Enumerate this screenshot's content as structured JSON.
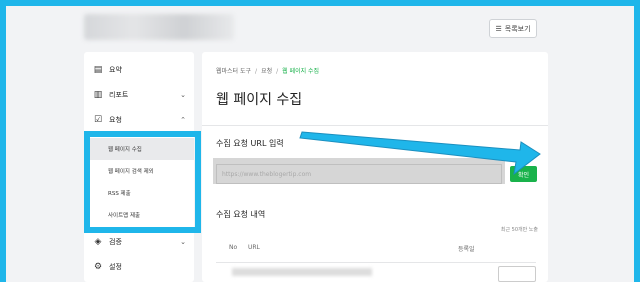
{
  "header": {
    "list_button_label": "목록보기",
    "list_icon": "list-icon"
  },
  "sidebar": {
    "items": [
      {
        "label": "요약",
        "icon": "clipboard-icon"
      },
      {
        "label": "리포트",
        "icon": "report-icon"
      },
      {
        "label": "요청",
        "icon": "checklist-icon"
      },
      {
        "label": "검증",
        "icon": "verify-icon"
      },
      {
        "label": "설정",
        "icon": "gear-icon"
      }
    ],
    "sub_items": [
      {
        "label": "웹 페이지 수집",
        "active": true
      },
      {
        "label": "웹 페이지 검색 제외",
        "active": false
      },
      {
        "label": "RSS 제출",
        "active": false
      },
      {
        "label": "사이트맵 제출",
        "active": false
      }
    ]
  },
  "main": {
    "breadcrumb": [
      "웹마스터 도구",
      "요청",
      "웹 페이지 수집"
    ],
    "title": "웹 페이지 수집",
    "url_section_title": "수집 요청 URL 입력",
    "url_placeholder": "https://www.theblogertip.com",
    "confirm_label": "확인",
    "history_title": "수집 요청 내역",
    "history_note": "최근 50개만 노출",
    "columns": [
      "No",
      "URL",
      "등록일"
    ]
  },
  "colors": {
    "accent": "#19b24b",
    "highlight": "#1fb6ea"
  }
}
